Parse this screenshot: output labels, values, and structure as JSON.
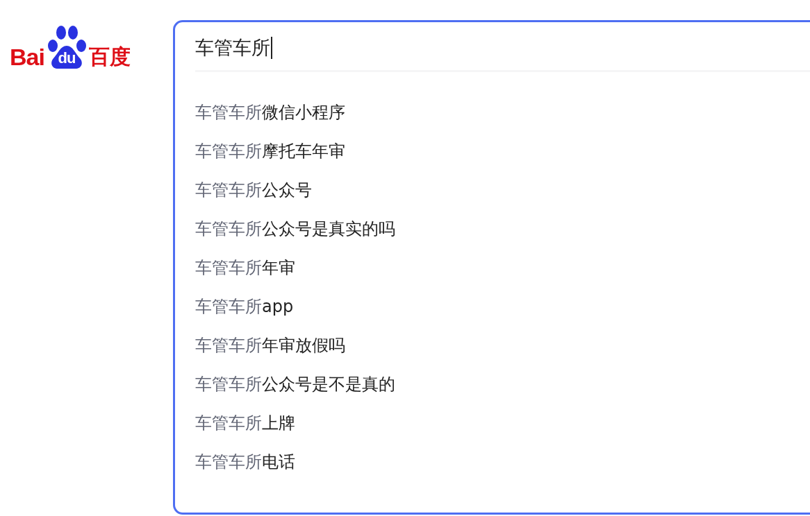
{
  "logo": {
    "left": "Bai",
    "paw": "du",
    "right": "百度"
  },
  "search": {
    "value": "车管车所"
  },
  "suggestions": [
    {
      "prefix": "车管车所",
      "suffix": "微信小程序"
    },
    {
      "prefix": "车管车所",
      "suffix": "摩托车年审"
    },
    {
      "prefix": "车管车所",
      "suffix": "公众号"
    },
    {
      "prefix": "车管车所",
      "suffix": "公众号是真实的吗"
    },
    {
      "prefix": "车管车所",
      "suffix": "年审"
    },
    {
      "prefix": "车管车所",
      "suffix": "app"
    },
    {
      "prefix": "车管车所",
      "suffix": "年审放假吗"
    },
    {
      "prefix": "车管车所",
      "suffix": "公众号是不是真的"
    },
    {
      "prefix": "车管车所",
      "suffix": "上牌"
    },
    {
      "prefix": "车管车所",
      "suffix": "电话"
    }
  ]
}
